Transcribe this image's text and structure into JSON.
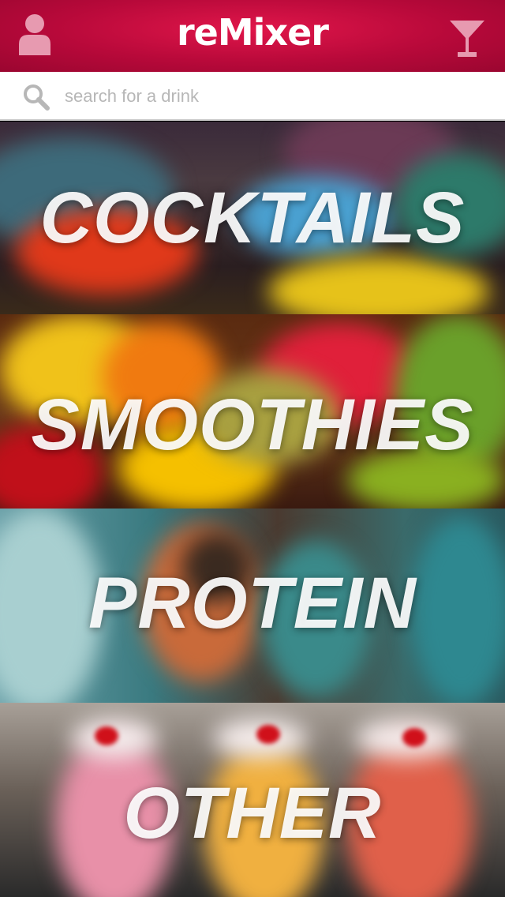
{
  "app": {
    "title": "reMixer"
  },
  "search": {
    "placeholder": "search for a drink",
    "value": ""
  },
  "categories": [
    {
      "label": "COCKTAILS"
    },
    {
      "label": "SMOOTHIES"
    },
    {
      "label": "PROTEIN"
    },
    {
      "label": "OTHER"
    }
  ],
  "colors": {
    "header": "#b8093a",
    "header_highlight": "#e0164a",
    "icon_tint": "#e79ab0",
    "search_icon": "#b7b7b7"
  },
  "icons": {
    "left": "profile-icon",
    "right": "cocktail-glass-icon",
    "search": "search-icon"
  }
}
